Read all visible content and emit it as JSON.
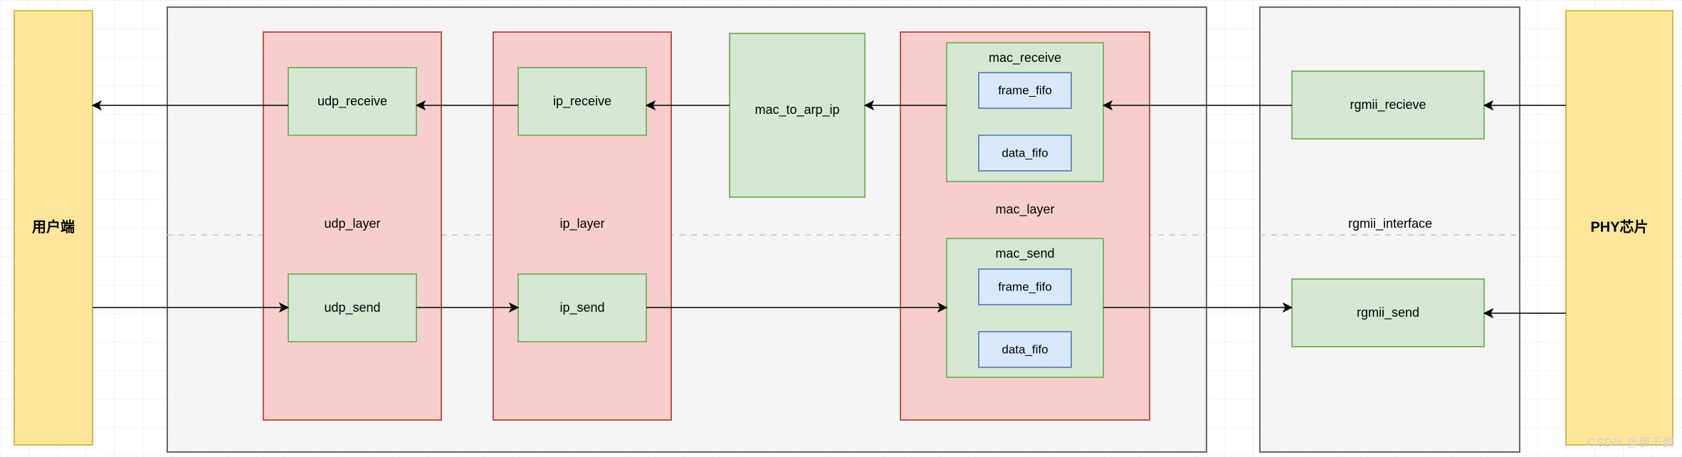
{
  "left_box": {
    "label": "用户端"
  },
  "right_box": {
    "label": "PHY芯片"
  },
  "udp_layer": {
    "label": "udp_layer",
    "receive": "udp_receive",
    "send": "udp_send"
  },
  "ip_layer": {
    "label": "ip_layer",
    "receive": "ip_receive",
    "send": "ip_send"
  },
  "mac_to_arp_ip": "mac_to_arp_ip",
  "mac_layer": {
    "label": "mac_layer",
    "receive": {
      "label": "mac_receive",
      "frame_fifo": "frame_fifo",
      "data_fifo": "data_fifo"
    },
    "send": {
      "label": "mac_send",
      "frame_fifo": "frame_fifo",
      "data_fifo": "data_fifo"
    }
  },
  "rgmii_interface": {
    "label": "rgmii_interface",
    "receive": "rgmii_recieve",
    "send": "rgmii_send"
  },
  "watermark": "CSDN @伊千韵",
  "colors": {
    "yellow_fill": "#ffe599",
    "yellow_stroke": "#d6b656",
    "gray_fill": "#f5f5f5",
    "gray_stroke": "#666666",
    "pink_fill": "#f8cecc",
    "pink_stroke": "#b85450",
    "green_fill": "#d5e8d4",
    "green_stroke": "#82b366",
    "blue_fill": "#dae8fc",
    "blue_stroke": "#6c8ebf",
    "arrow": "#000000",
    "dash": "#d0d0d0"
  }
}
